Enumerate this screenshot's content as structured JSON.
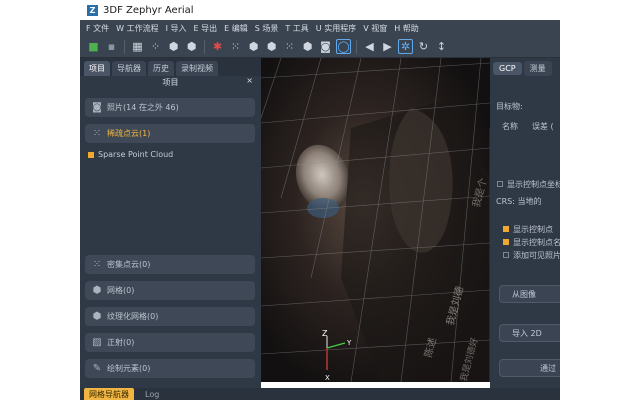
{
  "window": {
    "title": "3DF Zephyr Aerial",
    "logo_letter": "Z"
  },
  "menu": [
    "F 文件",
    "W 工作流程",
    "I 导入",
    "E 导出",
    "E 编辑",
    "S 场景",
    "T 工具",
    "U 实用程序",
    "V 视窗",
    "H 帮助"
  ],
  "left_panel": {
    "tabs": [
      "项目",
      "导航器",
      "历史",
      "录制视频"
    ],
    "active_tab": "项目",
    "title": "项目",
    "close": "×",
    "items": {
      "photos": "照片(14 在之外 46)",
      "sparse": "稀疏点云(1)",
      "sparse_child": "Sparse Point Cloud",
      "dense": "密集点云(0)",
      "mesh": "网格(0)",
      "textured": "纹理化网格(0)",
      "ortho": "正射(0)",
      "drawing": "绘制元素(0)"
    }
  },
  "viewport": {
    "axis_labels": {
      "z": "Z",
      "y": "Y",
      "x": "X"
    },
    "overlay_text": [
      "我是刘德",
      "陈述",
      "我是个",
      "我是刘德好"
    ]
  },
  "bottom_tabs": [
    "网格导航器",
    "Log"
  ],
  "right_panel": {
    "tabs": [
      "GCP",
      "测量"
    ],
    "active_tab": "GCP",
    "target_label": "目标物:",
    "col_name": "名称",
    "col_error": "误差 (",
    "show_coords": "显示控制点坐标",
    "crs": "CRS: 当地的",
    "opt1": "显示控制点",
    "opt2": "显示控制点名",
    "opt3": "添加可见照片",
    "btn_from_image": "从图像",
    "btn_import_2d": "导入 2D",
    "btn_bottom": "通过"
  },
  "colors": {
    "accent": "#f0b542",
    "panel": "#2f3845",
    "toolbar": "#3a4350"
  }
}
